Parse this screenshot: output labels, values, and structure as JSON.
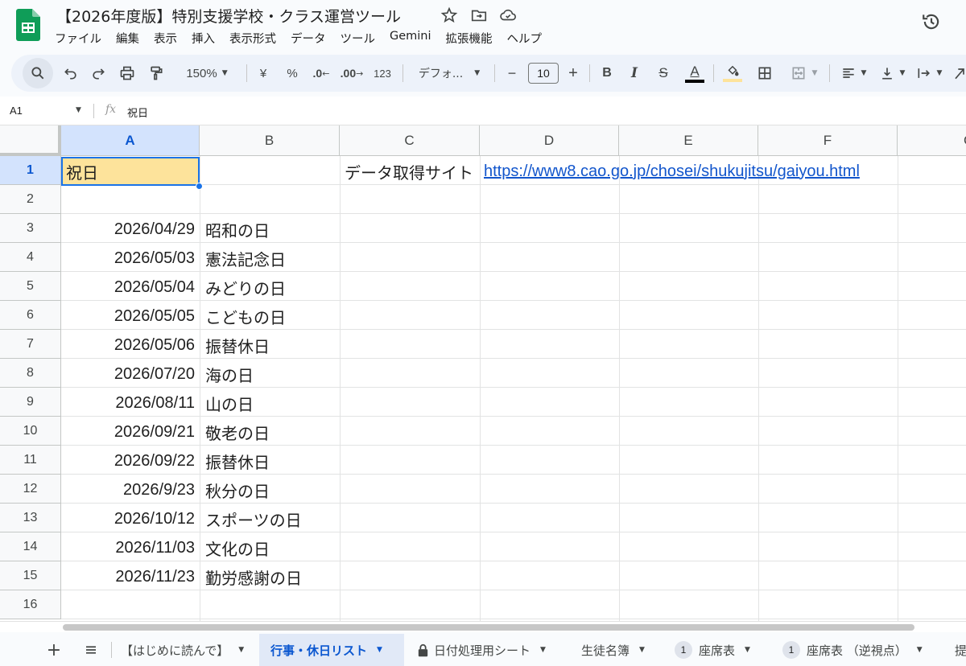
{
  "doc": {
    "title": "【2026年度版】特別支援学校・クラス運営ツール",
    "icons": [
      "star-icon",
      "move-to-folder-icon",
      "cloud-saved-icon",
      "version-history-icon"
    ]
  },
  "menu": [
    "ファイル",
    "編集",
    "表示",
    "挿入",
    "表示形式",
    "データ",
    "ツール",
    "Gemini",
    "拡張機能",
    "ヘルプ"
  ],
  "toolbar": {
    "zoom": "150%",
    "currency": "¥",
    "percent": "%",
    "decrease_decimal": ".0",
    "increase_decimal": ".00",
    "number_format": "123",
    "font": "デフォ...",
    "font_size": "10",
    "minus": "−",
    "plus": "+",
    "bold": "B",
    "italic": "I",
    "strike": "S",
    "text_color": "A",
    "colors": {
      "text_color_bar": "#000000",
      "fill_color_bar": "#fde39b"
    }
  },
  "formula_bar": {
    "cell_ref": "A1",
    "fx": "fx",
    "value": "祝日"
  },
  "grid": {
    "columns": [
      "A",
      "B",
      "C",
      "D",
      "E",
      "F",
      "G"
    ],
    "rows": [
      "1",
      "2",
      "3",
      "4",
      "5",
      "6",
      "7",
      "8",
      "9",
      "10",
      "11",
      "12",
      "13",
      "14",
      "15",
      "16"
    ],
    "a1": "祝日",
    "c1": "データ取得サイト",
    "d1": "https://www8.cao.go.jp/chosei/shukujitsu/gaiyou.html",
    "holidays": [
      {
        "date": "2026/04/29",
        "name": "昭和の日"
      },
      {
        "date": "2026/05/03",
        "name": "憲法記念日"
      },
      {
        "date": "2026/05/04",
        "name": "みどりの日"
      },
      {
        "date": "2026/05/05",
        "name": "こどもの日"
      },
      {
        "date": "2026/05/06",
        "name": "振替休日"
      },
      {
        "date": "2026/07/20",
        "name": "海の日"
      },
      {
        "date": "2026/08/11",
        "name": "山の日"
      },
      {
        "date": "2026/09/21",
        "name": "敬老の日"
      },
      {
        "date": "2026/09/22",
        "name": "振替休日"
      },
      {
        "date": "2026/9/23",
        "name": "秋分の日"
      },
      {
        "date": "2026/10/12",
        "name": "スポーツの日"
      },
      {
        "date": "2026/11/03",
        "name": "文化の日"
      },
      {
        "date": "2026/11/23",
        "name": "勤労感謝の日"
      }
    ],
    "selection_color": "#1a73e8",
    "link_color": "#1155cc"
  },
  "sheets": {
    "add": "+",
    "tabs": [
      {
        "label": "【はじめに読んで】",
        "active": false
      },
      {
        "label": "行事・休日リスト",
        "active": true
      },
      {
        "label": "日付処理用シート",
        "active": false,
        "locked": true
      },
      {
        "label": "生徒名簿",
        "active": false
      },
      {
        "label": "座席表",
        "active": false,
        "badge": "1"
      },
      {
        "label": "座席表 （逆視点）",
        "active": false,
        "badge": "1"
      },
      {
        "label": "提",
        "active": false
      }
    ]
  }
}
